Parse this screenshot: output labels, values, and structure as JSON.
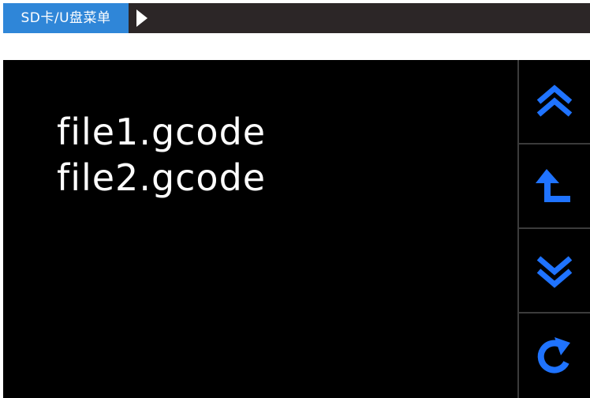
{
  "header": {
    "title": "SD卡/U盘菜单",
    "title_bg": "#2f86d8",
    "bar_bg": "#2c2627",
    "next_icon": "play-triangle"
  },
  "files": [
    {
      "name": "file1.gcode"
    },
    {
      "name": "file2.gcode"
    }
  ],
  "side_buttons": [
    {
      "icon": "double-chevron-up-icon",
      "action": "page-up"
    },
    {
      "icon": "return-up-icon",
      "action": "parent-folder"
    },
    {
      "icon": "double-chevron-down-icon",
      "action": "page-down"
    },
    {
      "icon": "refresh-icon",
      "action": "refresh"
    }
  ],
  "colors": {
    "screen_bg": "#000000",
    "text": "#ffffff",
    "accent": "#1f73ff",
    "divider": "#3b3b3b"
  }
}
